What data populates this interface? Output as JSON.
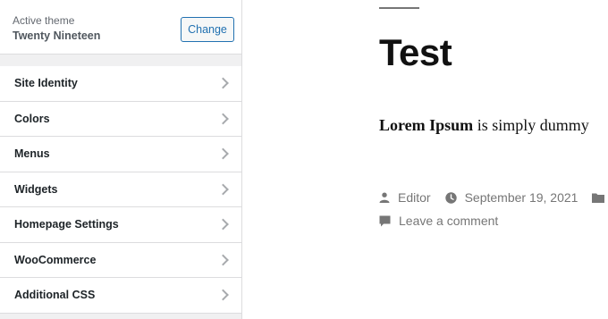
{
  "sidebar": {
    "theme": {
      "label": "Active theme",
      "name": "Twenty Nineteen",
      "change_label": "Change"
    },
    "items": [
      {
        "label": "Site Identity"
      },
      {
        "label": "Colors"
      },
      {
        "label": "Menus"
      },
      {
        "label": "Widgets"
      },
      {
        "label": "Homepage Settings"
      },
      {
        "label": "WooCommerce"
      },
      {
        "label": "Additional CSS"
      }
    ]
  },
  "preview": {
    "title": "Test",
    "excerpt_bold": "Lorem Ipsum",
    "excerpt_rest": " is simply dummy",
    "meta": {
      "author": "Editor",
      "date": "September 19, 2021",
      "comment": "Leave a comment"
    }
  },
  "colors": {
    "accent": "#2271b1",
    "meta_text": "#767676",
    "title_text": "#111111"
  }
}
